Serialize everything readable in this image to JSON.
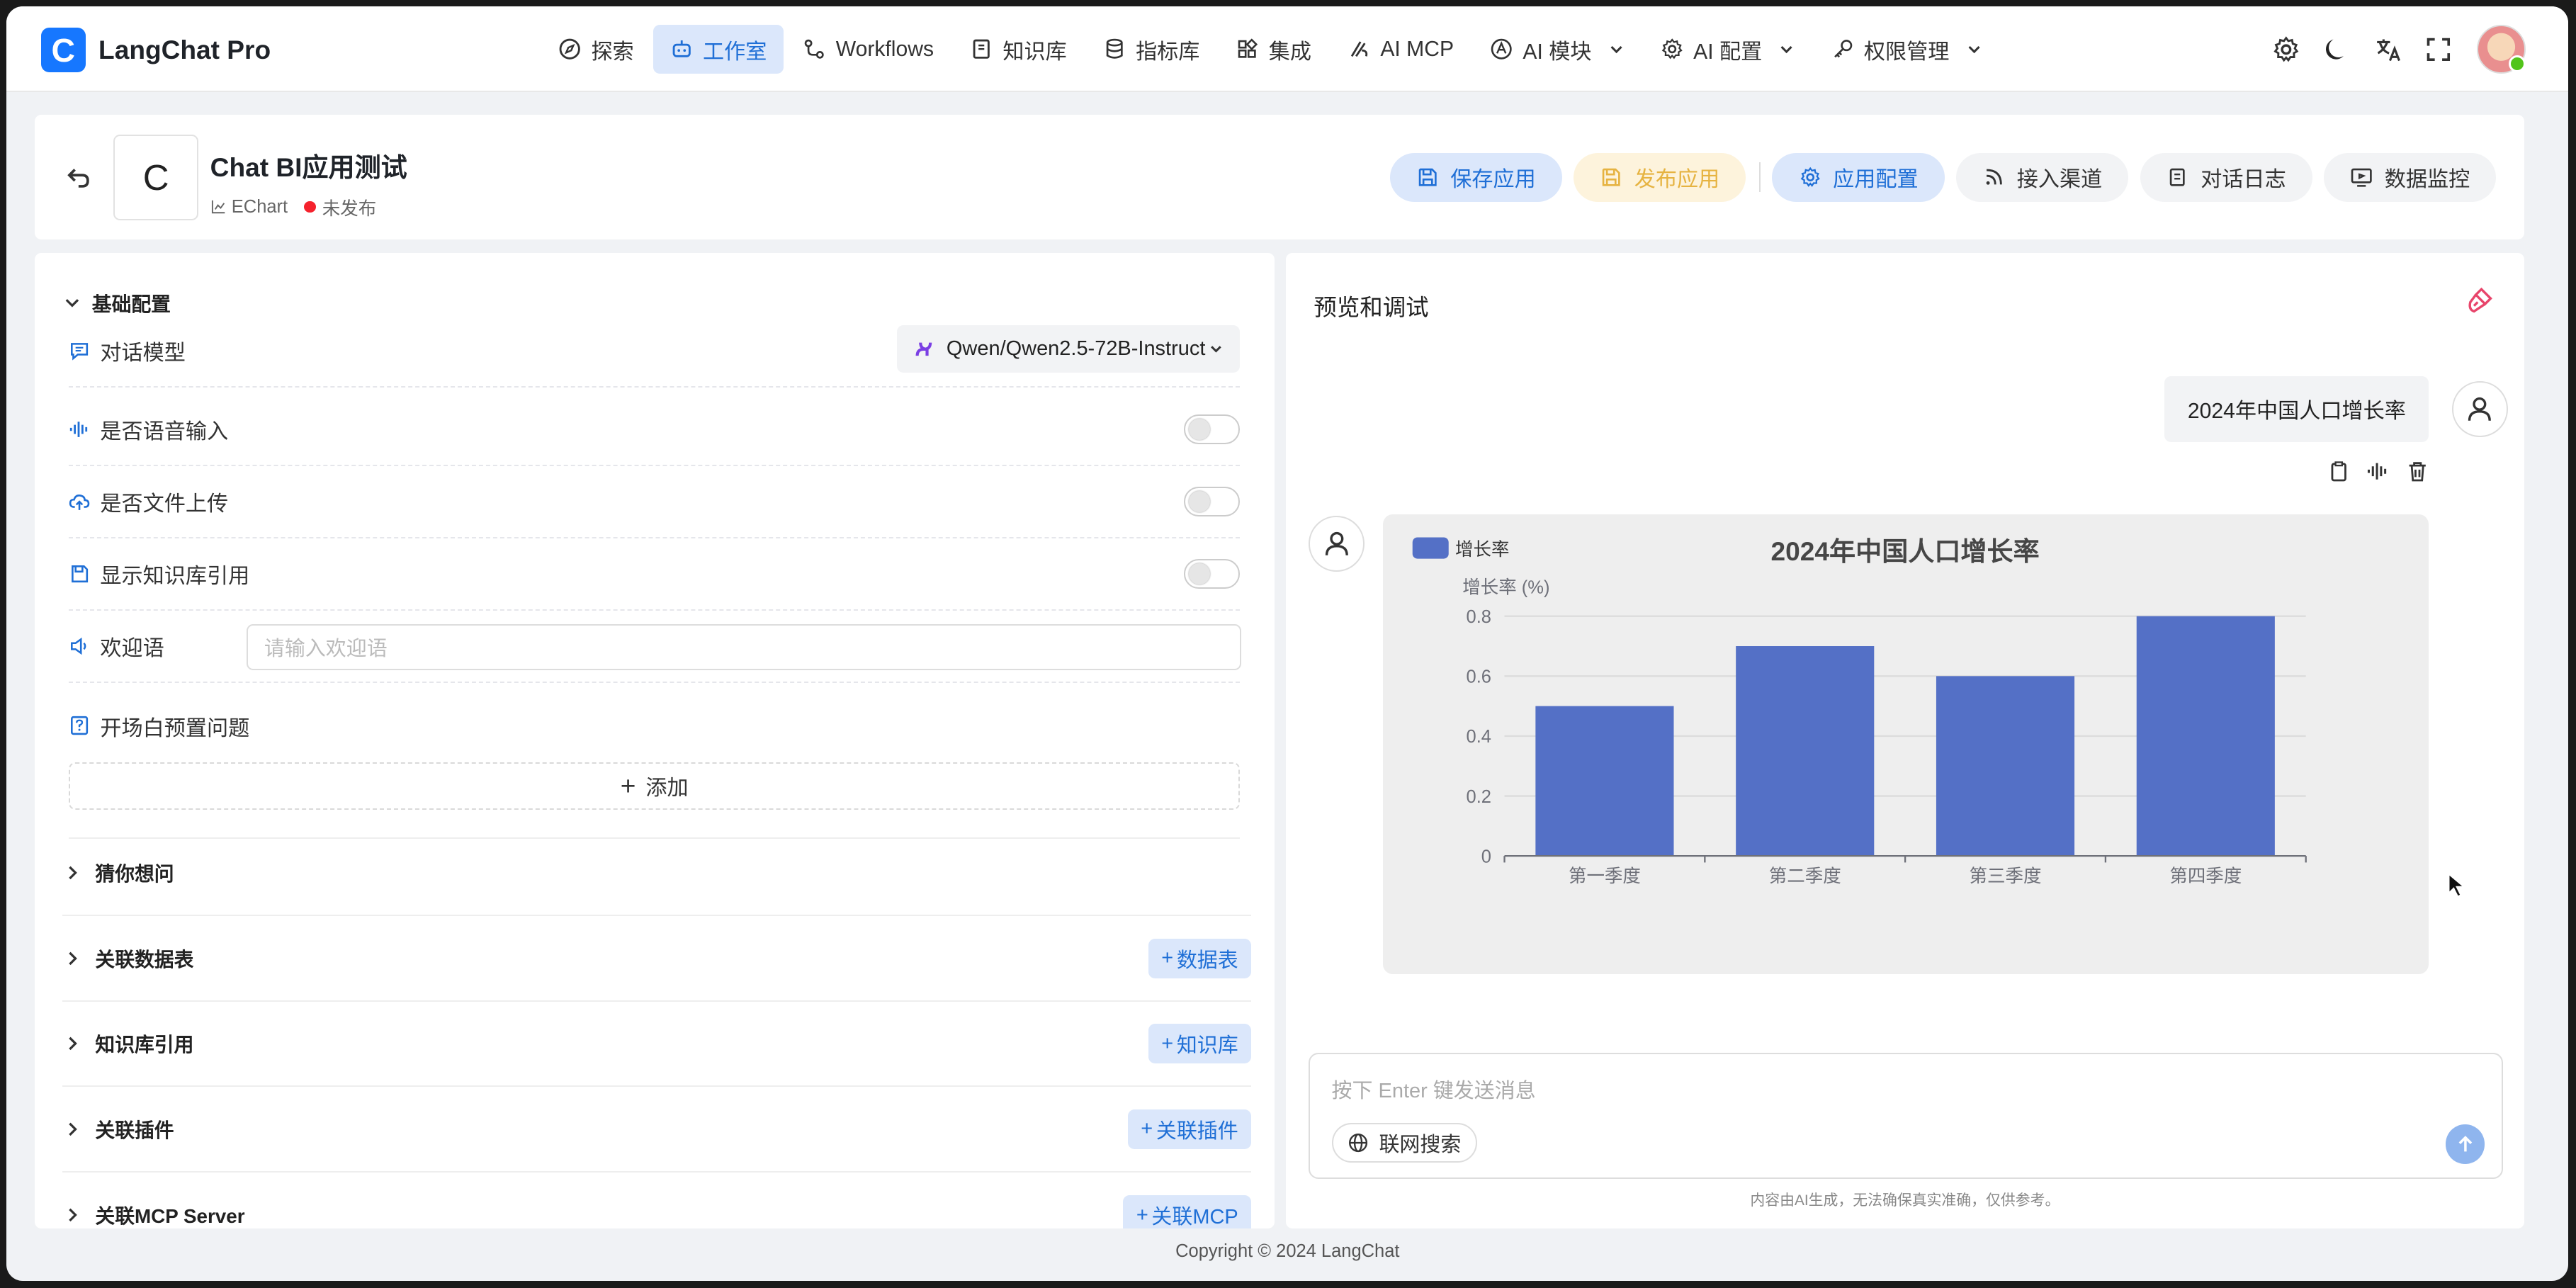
{
  "brand": {
    "logo_letter": "C",
    "name": "LangChat Pro"
  },
  "nav": [
    {
      "label": "探索",
      "icon": "compass-icon",
      "active": false
    },
    {
      "label": "工作室",
      "icon": "robot-icon",
      "active": true
    },
    {
      "label": "Workflows",
      "icon": "workflow-icon",
      "active": false
    },
    {
      "label": "知识库",
      "icon": "book-icon",
      "active": false
    },
    {
      "label": "指标库",
      "icon": "database-icon",
      "active": false
    },
    {
      "label": "集成",
      "icon": "grid-icon",
      "active": false
    },
    {
      "label": "AI MCP",
      "icon": "mcp-icon",
      "active": false
    },
    {
      "label": "AI 模块",
      "icon": "ai-module-icon",
      "active": false,
      "dropdown": true
    },
    {
      "label": "AI 配置",
      "icon": "gear-icon",
      "active": false,
      "dropdown": true
    },
    {
      "label": "权限管理",
      "icon": "key-icon",
      "active": false,
      "dropdown": true
    }
  ],
  "app": {
    "logo_letter": "C",
    "title": "Chat BI应用测试",
    "type": "EChart",
    "status": "未发布"
  },
  "actions": {
    "save": "保存应用",
    "publish": "发布应用",
    "config": "应用配置",
    "channel": "接入渠道",
    "logs": "对话日志",
    "monitor": "数据监控"
  },
  "left": {
    "basic_section": "基础配置",
    "model_label": "对话模型",
    "model_value": "Qwen/Qwen2.5-72B-Instruct",
    "voice_input": "是否语音输入",
    "file_upload": "是否文件上传",
    "show_kb_ref": "显示知识库引用",
    "welcome_label": "欢迎语",
    "welcome_placeholder": "请输入欢迎语",
    "preset_label": "开场白预置问题",
    "add_label": "添加",
    "guess_section": "猜你想问",
    "table_section": "关联数据表",
    "table_button": "数据表",
    "kb_section": "知识库引用",
    "kb_button": "知识库",
    "plugin_section": "关联插件",
    "plugin_button": "关联插件",
    "mcp_section": "关联MCP Server",
    "mcp_button": "关联MCP"
  },
  "right": {
    "title": "预览和调试",
    "user_message": "2024年中国人口增长率",
    "input_placeholder": "按下 Enter 键发送消息",
    "web_search": "联网搜索",
    "disclaimer": "内容由AI生成，无法确保真实准确，仅供参考。"
  },
  "chart_data": {
    "type": "bar",
    "title": "2024年中国人口增长率",
    "legend": [
      "增长率"
    ],
    "legend_position": "top-left",
    "ylabel": "增长率 (%)",
    "xlabel": "",
    "categories": [
      "第一季度",
      "第二季度",
      "第三季度",
      "第四季度"
    ],
    "series": [
      {
        "name": "增长率",
        "values": [
          0.5,
          0.7,
          0.6,
          0.8
        ]
      }
    ],
    "ylim": [
      0,
      0.8
    ],
    "yticks": [
      "0",
      "0.2",
      "0.4",
      "0.6",
      "0.8"
    ],
    "color": "#5470c6",
    "grid": true
  },
  "footer": "Copyright © 2024 LangChat"
}
